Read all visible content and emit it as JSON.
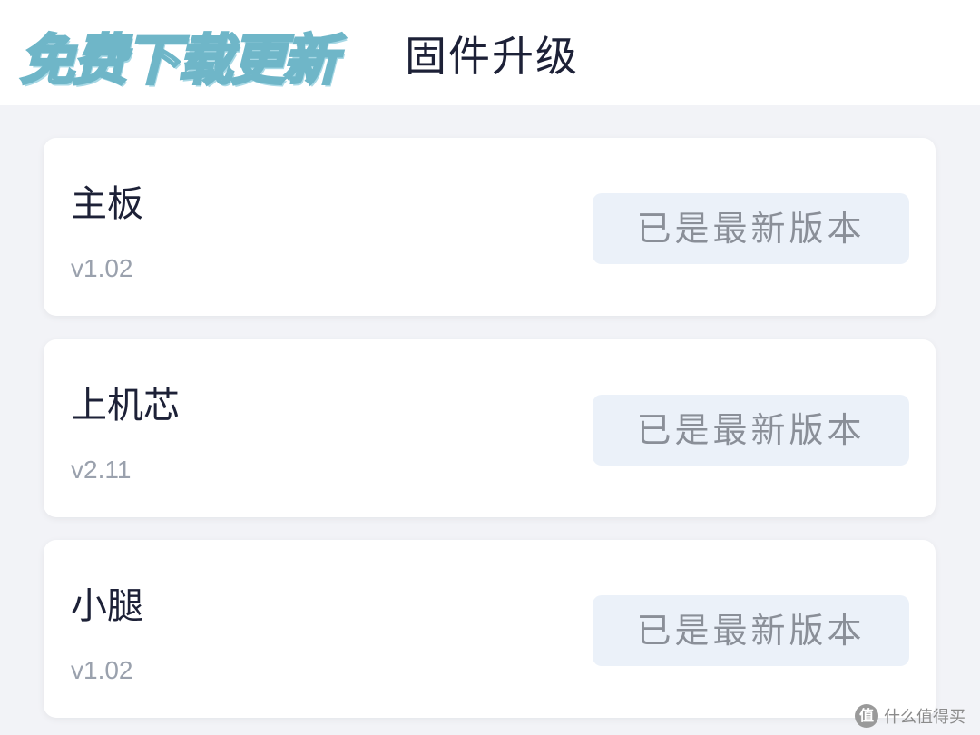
{
  "header": {
    "overlay_text": "免费下载更新",
    "title": "固件升级"
  },
  "firmware_items": [
    {
      "name": "主板",
      "version": "v1.02",
      "status_label": "已是最新版本"
    },
    {
      "name": "上机芯",
      "version": "v2.11",
      "status_label": "已是最新版本"
    },
    {
      "name": "小腿",
      "version": "v1.02",
      "status_label": "已是最新版本"
    }
  ],
  "watermark": {
    "icon_char": "值",
    "text": "什么值得买"
  },
  "colors": {
    "background": "#f2f3f7",
    "card": "#ffffff",
    "status_button_bg": "#ebf1f9",
    "status_button_text": "#8a8f98",
    "title_text": "#1d2137",
    "version_text": "#9aa1ad"
  }
}
